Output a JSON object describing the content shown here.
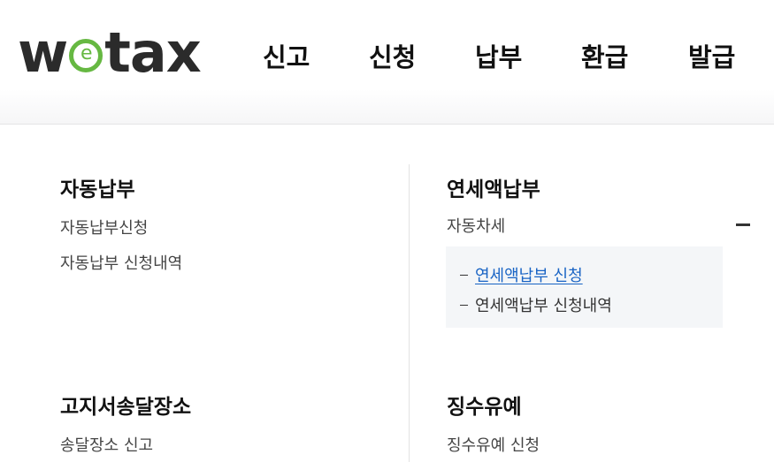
{
  "logo": {
    "pre": "w",
    "ring_letter": "e",
    "post": "tax"
  },
  "gnb": {
    "items": [
      {
        "label": "신고"
      },
      {
        "label": "신청"
      },
      {
        "label": "납부"
      },
      {
        "label": "환급"
      },
      {
        "label": "발급"
      }
    ]
  },
  "sections": {
    "auto_payment": {
      "title": "자동납부",
      "items": [
        "자동납부신청",
        "자동납부 신청내역"
      ]
    },
    "annual_payment": {
      "title": "연세액납부",
      "group": {
        "label": "자동차세",
        "expanded": true,
        "items": [
          "연세액납부 신청",
          "연세액납부 신청내역"
        ],
        "active_index": 0
      }
    },
    "notice_address": {
      "title": "고지서송달장소",
      "items": [
        "송달장소 신고"
      ]
    },
    "deferral": {
      "title": "징수유예",
      "items": [
        "징수유예 신청"
      ]
    }
  },
  "colors": {
    "brand_green": "#66b842",
    "link_blue": "#1863c4",
    "submenu_bg": "#f4f6f8"
  }
}
